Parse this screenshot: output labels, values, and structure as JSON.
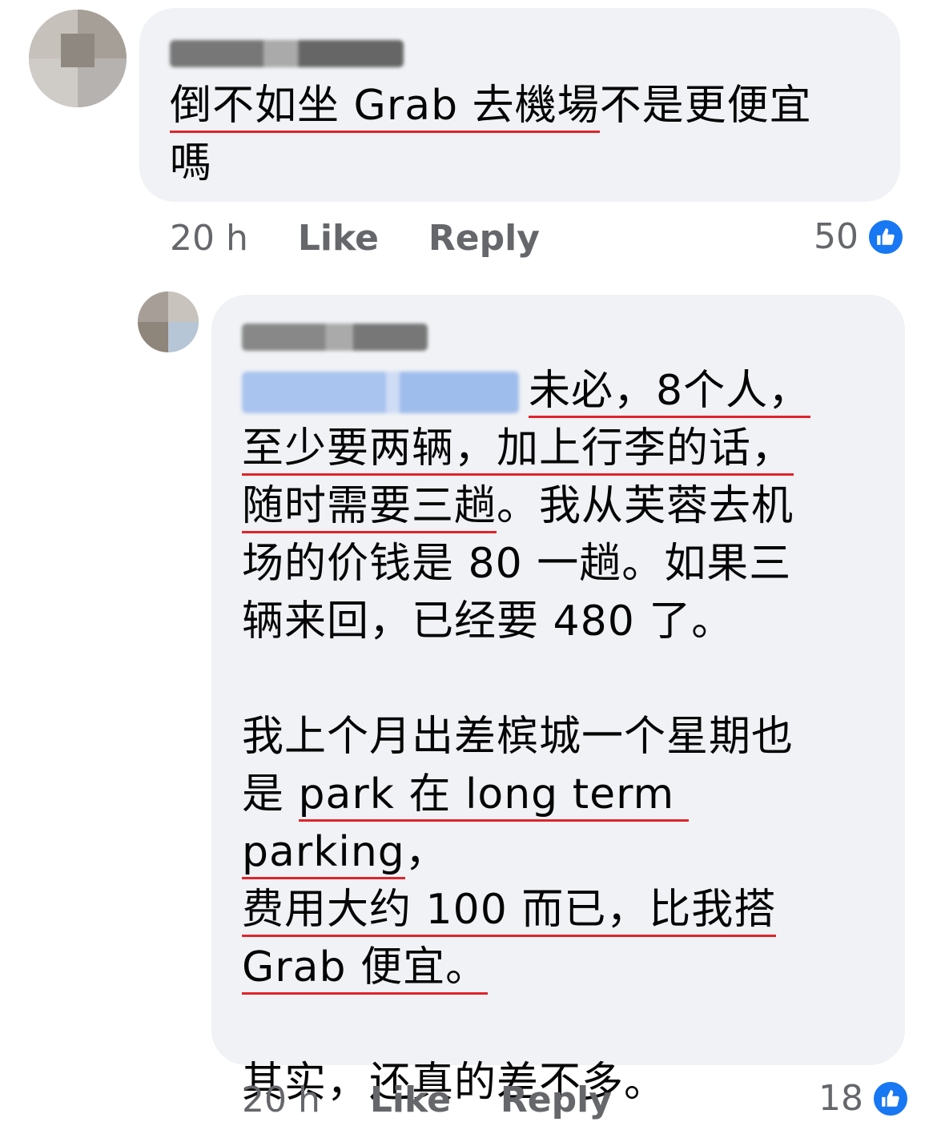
{
  "comments": [
    {
      "lines": [
        [
          {
            "t": "倒不如坐 Grab 去機場",
            "u": true
          },
          {
            "t": "不是更便宜",
            "u": false
          }
        ],
        [
          {
            "t": "嗎",
            "u": false
          }
        ]
      ],
      "time": "20 h",
      "like_label": "Like",
      "reply_label": "Reply",
      "reaction_count": "50"
    },
    {
      "lines": [
        [
          {
            "t": "未必，8个人，",
            "u": true
          }
        ],
        [
          {
            "t": "至少要两辆，加上行李的话，",
            "u": true
          }
        ],
        [
          {
            "t": "随时需要三趟",
            "u": true
          },
          {
            "t": "。我从芙蓉去机",
            "u": false
          }
        ],
        [
          {
            "t": "场的价钱是 80 一趟。如果三",
            "u": false
          }
        ],
        [
          {
            "t": "辆来回，已经要 480 了。",
            "u": false
          }
        ],
        [
          {
            "t": "",
            "u": false
          }
        ],
        [
          {
            "t": "我上个月出差槟城一个星期也",
            "u": false
          }
        ],
        [
          {
            "t": "是 ",
            "u": false
          },
          {
            "t": "park 在 long term parking",
            "u": true
          },
          {
            "t": "，",
            "u": false
          }
        ],
        [
          {
            "t": "费用大约 100 而已，比我搭",
            "u": true
          }
        ],
        [
          {
            "t": "Grab 便宜。",
            "u": true
          }
        ],
        [
          {
            "t": "",
            "u": false
          }
        ],
        [
          {
            "t": "其实，还真的差不多。",
            "u": false
          }
        ]
      ],
      "time": "20 h",
      "like_label": "Like",
      "reply_label": "Reply",
      "reaction_count": "18"
    }
  ],
  "colors": {
    "bubble": "#f0f2f5",
    "underline": "#e0242b",
    "meta": "#65676b",
    "like_blue": "#1877f2",
    "mention_blur": "#a9c4ef"
  },
  "icons": {
    "reaction": "thumbs-up-icon"
  }
}
